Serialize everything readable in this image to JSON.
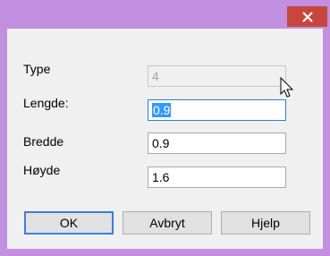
{
  "titlebar": {
    "close_icon": "close-icon"
  },
  "form": {
    "type_label": "Type",
    "type_value": "4",
    "length_label": "Lengde:",
    "length_value": "0.9",
    "width_label": "Bredde",
    "width_value": "0.9",
    "height_label": "Høyde",
    "height_value": "1.6"
  },
  "buttons": {
    "ok": "OK",
    "cancel": "Avbryt",
    "help": "Hjelp"
  },
  "colors": {
    "frame": "#c38fe0",
    "close": "#c7473f",
    "selection": "#3399ff",
    "default_button_border": "#3c7fd8"
  },
  "cursor_icon": "arrow-cursor-icon"
}
